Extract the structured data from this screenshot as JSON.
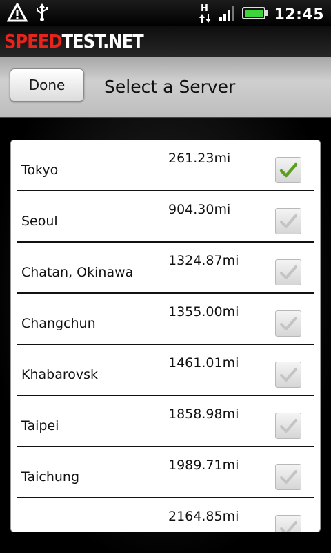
{
  "status_bar": {
    "time": "12:45",
    "network_type": "H",
    "icons": [
      "warning-icon",
      "usb-icon",
      "hspa-data-icon",
      "signal-icon",
      "battery-icon"
    ]
  },
  "brand": {
    "logo_part1": "SPEED",
    "logo_part2": "TEST.NET"
  },
  "header": {
    "done_label": "Done",
    "title": "Select a Server"
  },
  "colors": {
    "brand_red": "#e8231c",
    "check_green": "#5aa01e",
    "check_grey": "#c4c4c4"
  },
  "servers": [
    {
      "name": "Tokyo",
      "distance": "261.23mi",
      "selected": true
    },
    {
      "name": "Seoul",
      "distance": "904.30mi",
      "selected": false
    },
    {
      "name": "Chatan, Okinawa",
      "distance": "1324.87mi",
      "selected": false
    },
    {
      "name": "Changchun",
      "distance": "1355.00mi",
      "selected": false
    },
    {
      "name": "Khabarovsk",
      "distance": "1461.01mi",
      "selected": false
    },
    {
      "name": "Taipei",
      "distance": "1858.98mi",
      "selected": false
    },
    {
      "name": "Taichung",
      "distance": "1989.71mi",
      "selected": false
    },
    {
      "name": "",
      "distance": "2164.85mi",
      "selected": false
    }
  ]
}
